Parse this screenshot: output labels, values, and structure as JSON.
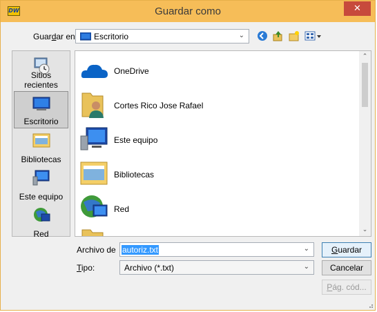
{
  "window": {
    "title": "Guardar como",
    "app_icon_text": "DW",
    "close_symbol": "✕"
  },
  "location": {
    "label_prefix": "Guar",
    "label_accel": "d",
    "label_suffix": "ar en:",
    "value": "Escritorio"
  },
  "toolbar": {
    "icons": [
      "back-icon",
      "up-folder-icon",
      "new-folder-icon",
      "view-menu-icon"
    ]
  },
  "places": [
    {
      "label": "Sitios recientes",
      "icon": "recent-places-icon",
      "selected": false
    },
    {
      "label": "Escritorio",
      "icon": "desktop-icon",
      "selected": true
    },
    {
      "label": "Bibliotecas",
      "icon": "libraries-icon",
      "selected": false
    },
    {
      "label": "Este equipo",
      "icon": "this-pc-icon",
      "selected": false
    },
    {
      "label": "Red",
      "icon": "network-icon",
      "selected": false
    }
  ],
  "files": [
    {
      "name": "OneDrive",
      "icon": "onedrive-icon"
    },
    {
      "name": "Cortes Rico Jose Rafael",
      "icon": "user-folder-icon"
    },
    {
      "name": "Este equipo",
      "icon": "this-pc-icon"
    },
    {
      "name": "Bibliotecas",
      "icon": "libraries-icon"
    },
    {
      "name": "Red",
      "icon": "network-icon"
    },
    {
      "name": "",
      "icon": "folder-icon"
    }
  ],
  "filename": {
    "label": "Archivo de",
    "value": "autoriz.txt"
  },
  "filetype": {
    "label_accel": "T",
    "label_rest": "ipo:",
    "value": "Archivo (*.txt)"
  },
  "buttons": {
    "save_accel": "G",
    "save_rest": "uardar",
    "cancel": "Cancelar",
    "codepage_accel": "P",
    "codepage_rest": "ág. cód..."
  },
  "colors": {
    "titlebar": "#f6bd58",
    "close": "#c74a3c",
    "selection": "#3399ff"
  }
}
